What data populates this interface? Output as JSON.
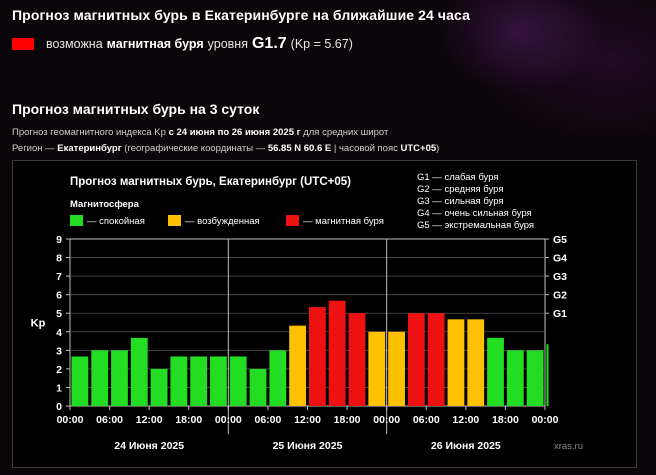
{
  "header": {
    "title": "Прогноз магнитных бурь в Екатеринбурге на ближайшие 24 часа",
    "level_prefix": "возможна",
    "level_strong": "магнитная буря",
    "level_mid": "уровня",
    "level_value": "G1.7",
    "level_kp": "(Kp = 5.67)",
    "swatch_color": "#ff0000"
  },
  "section": {
    "title": "Прогноз магнитных бурь на 3 суток",
    "line1_a": "Прогноз геомагнитного индекса Kp",
    "line1_b": "с 24 июня по 26 июня 2025 г",
    "line1_c": "для средних широт",
    "line2_a": "Регион —",
    "line2_b": "Екатеринбург",
    "line2_c": "(географические координаты —",
    "line2_d": "56.85 N 60.6 E",
    "line2_e": "| часовой пояс",
    "line2_f": "UTC+05",
    "line2_g": ")"
  },
  "chart_data": {
    "type": "bar",
    "title": "Прогноз магнитных бурь, Екатеринбург (UTC+05)",
    "legend_title": "Магнитосфера",
    "legend": [
      {
        "label": "— спокойная",
        "color": "#22dd22"
      },
      {
        "label": "— возбужденная",
        "color": "#ffc000"
      },
      {
        "label": "— магнитная буря",
        "color": "#ee1111"
      }
    ],
    "g_legend": [
      "G1 — слабая буря",
      "G2 — средняя буря",
      "G3 — сильная буря",
      "G4 — очень сильная буря",
      "G5 — экстремальная буря"
    ],
    "ylabel": "Kp",
    "ylim": [
      0,
      9
    ],
    "y_ticks": [
      "0",
      "1",
      "2",
      "3",
      "4",
      "5",
      "6",
      "7",
      "8",
      "9"
    ],
    "g_ticks": [
      {
        "label": "G1",
        "kp": 5
      },
      {
        "label": "G2",
        "kp": 6
      },
      {
        "label": "G3",
        "kp": 7
      },
      {
        "label": "G4",
        "kp": 8
      },
      {
        "label": "G5",
        "kp": 9
      }
    ],
    "x_tick_labels": [
      "00:00",
      "06:00",
      "12:00",
      "18:00",
      "00:00",
      "06:00",
      "12:00",
      "18:00",
      "00:00",
      "06:00",
      "12:00",
      "18:00",
      "00:00"
    ],
    "day_labels": [
      "24 Июня 2025",
      "25 Июня 2025",
      "26 Июня 2025"
    ],
    "interval_hours": 3,
    "values": [
      2.67,
      3.0,
      3.0,
      3.67,
      2.0,
      2.67,
      2.67,
      2.67,
      2.67,
      2.0,
      3.0,
      4.33,
      5.33,
      5.67,
      5.0,
      4.0,
      4.0,
      5.0,
      5.0,
      4.67,
      4.67,
      3.67,
      3.0,
      3.0,
      3.33
    ],
    "colors": {
      "quiet": "#22dd22",
      "active": "#ffc000",
      "storm": "#ee1111"
    },
    "watermark": "xras.ru"
  }
}
